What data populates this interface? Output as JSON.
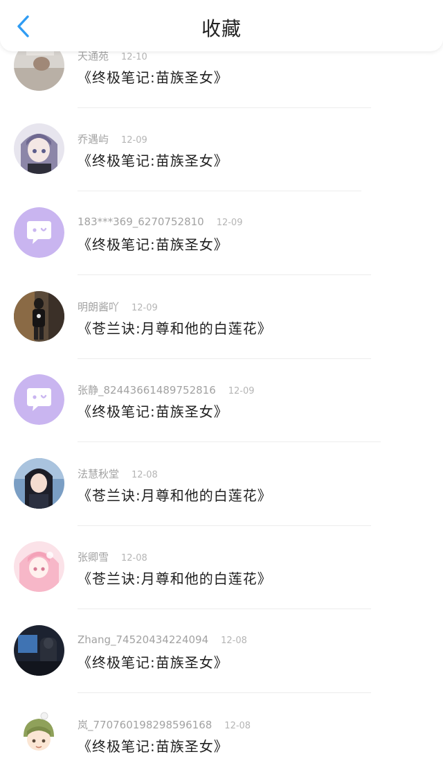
{
  "header": {
    "title": "收藏"
  },
  "items": [
    {
      "user": "天通苑",
      "date": "12-10",
      "book": "《终极笔记:苗族圣女》",
      "avatar": "photo-avatar"
    },
    {
      "user": "乔遇屿",
      "date": "12-09",
      "book": "《终极笔记:苗族圣女》",
      "avatar": "anime-girl-avatar"
    },
    {
      "user": "183***369_6270752810",
      "date": "12-09",
      "book": "《终极笔记:苗族圣女》",
      "avatar": "default-chat-avatar"
    },
    {
      "user": "明朗酱吖",
      "date": "12-09",
      "book": "《苍兰诀:月尊和他的白莲花》",
      "avatar": "photo-avatar"
    },
    {
      "user": "张静_82443661489752816",
      "date": "12-09",
      "book": "《终极笔记:苗族圣女》",
      "avatar": "default-chat-avatar"
    },
    {
      "user": "法慧秋堂",
      "date": "12-08",
      "book": "《苍兰诀:月尊和他的白莲花》",
      "avatar": "anime-girl-avatar"
    },
    {
      "user": "张卿雪",
      "date": "12-08",
      "book": "《苍兰诀:月尊和他的白莲花》",
      "avatar": "anime-girl-avatar"
    },
    {
      "user": "Zhang_74520434224094",
      "date": "12-08",
      "book": "《终极笔记:苗族圣女》",
      "avatar": "photo-avatar"
    },
    {
      "user": "岚_77076019829859616​8",
      "date": "12-08",
      "book": "《终极笔记:苗族圣女》",
      "avatar": "anime-boy-avatar"
    }
  ],
  "colors": {
    "accent": "#2f9cf3",
    "default_avatar_bg": "#c9b5f0"
  }
}
